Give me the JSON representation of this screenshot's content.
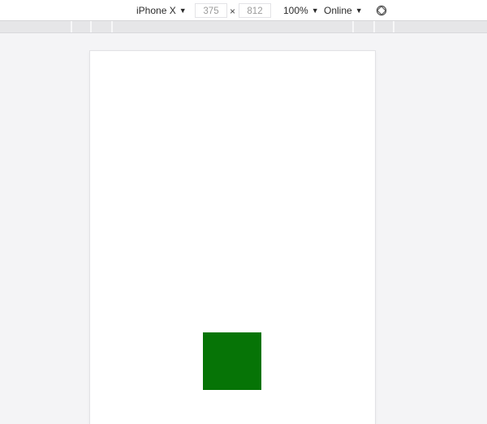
{
  "toolbar": {
    "device_label": "iPhone X",
    "width_value": "375",
    "height_value": "812",
    "times_symbol": "×",
    "zoom_label": "100%",
    "network_label": "Online",
    "caret": "▼",
    "rotate_icon": "rotate-icon"
  },
  "viewport": {
    "background": "#ffffff",
    "box_color": "#067406"
  }
}
